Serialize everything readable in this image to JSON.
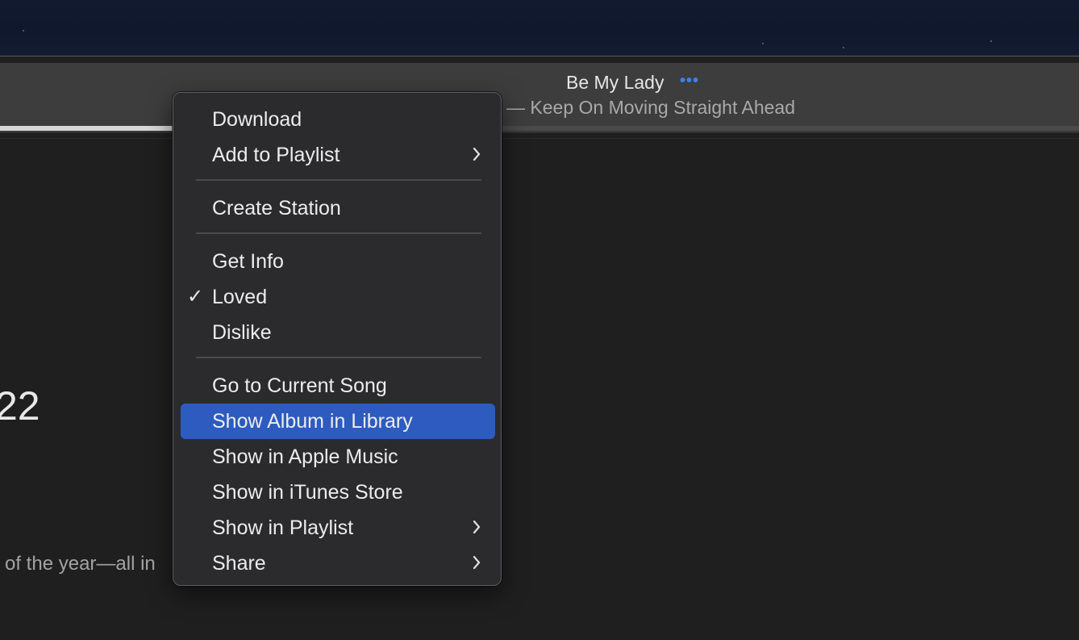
{
  "now_playing": {
    "title": "Be My Lady",
    "more_icon": "ellipsis-icon",
    "subtitle": "— Keep On Moving Straight Ahead",
    "progress_fraction": 0.16
  },
  "background": {
    "year_fragment": "22",
    "caption_fragment": "of the year—all in"
  },
  "context_menu": {
    "items": [
      {
        "label": "Download"
      },
      {
        "label": "Add to Playlist",
        "submenu": true
      },
      {
        "label": "Create Station"
      },
      {
        "label": "Get Info"
      },
      {
        "label": "Loved",
        "checked": true
      },
      {
        "label": "Dislike"
      },
      {
        "label": "Go to Current Song"
      },
      {
        "label": "Show Album in Library",
        "highlighted": true
      },
      {
        "label": "Show in Apple Music"
      },
      {
        "label": "Show in iTunes Store"
      },
      {
        "label": "Show in Playlist",
        "submenu": true
      },
      {
        "label": "Share",
        "submenu": true
      }
    ],
    "check_glyph": "✓"
  },
  "colors": {
    "highlight": "#2d5bbf",
    "accent_dots": "#3a82f7",
    "menu_bg": "#2b2b2d"
  }
}
